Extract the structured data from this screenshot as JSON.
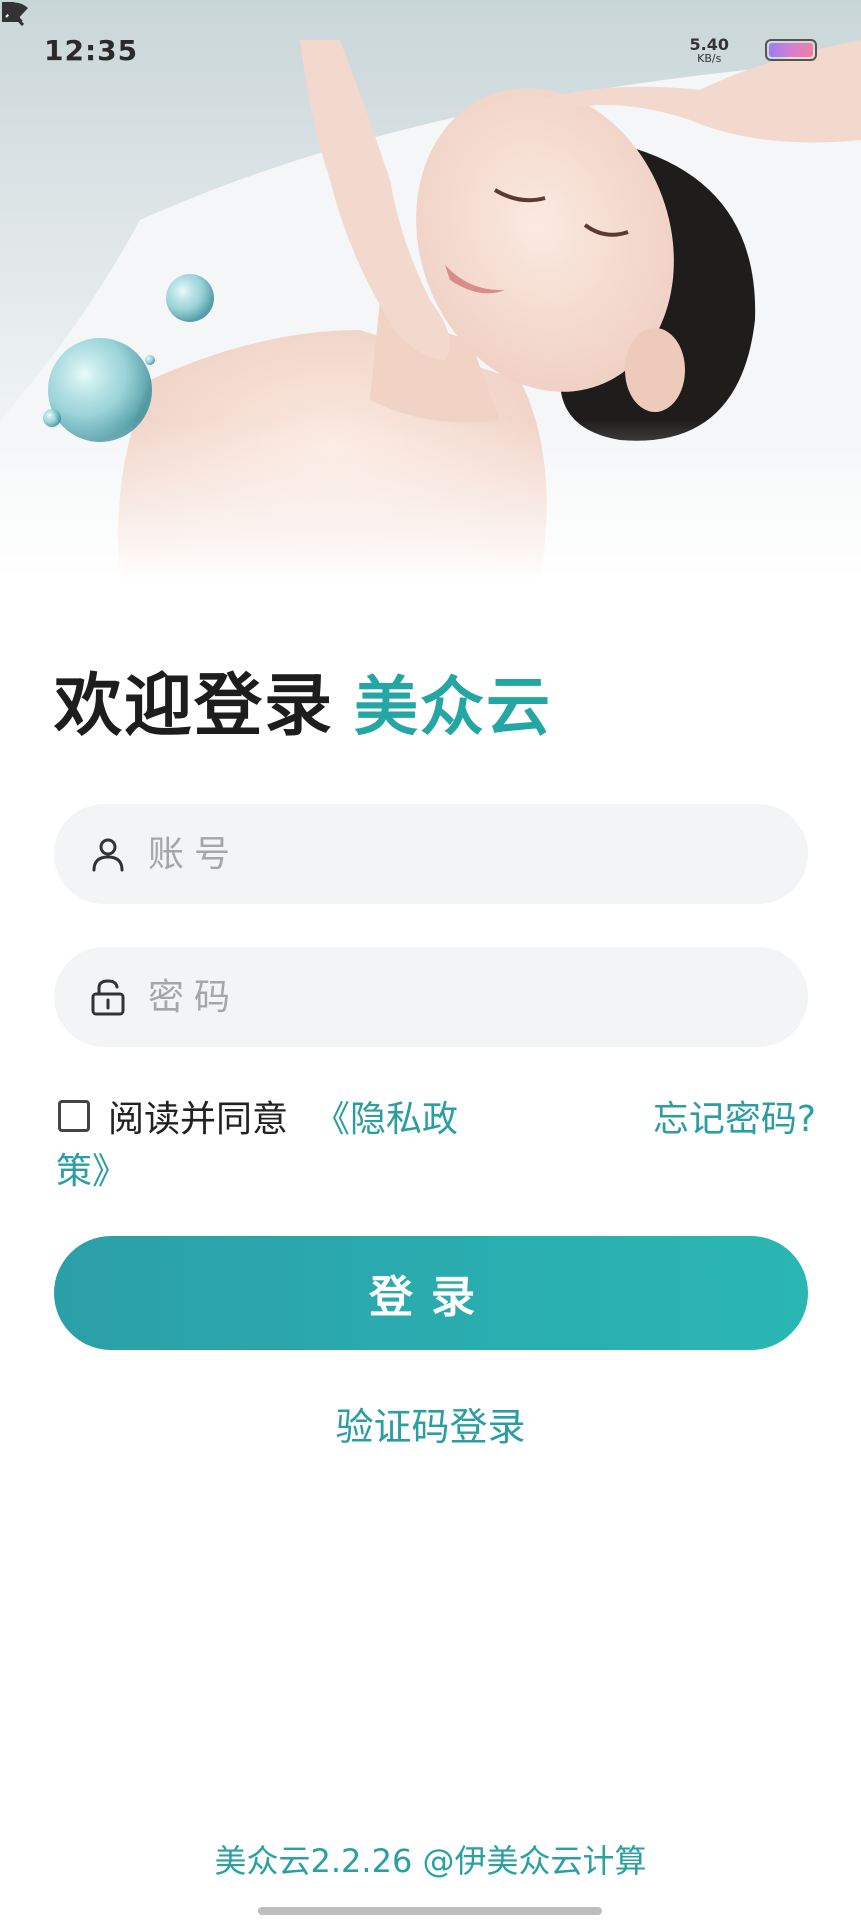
{
  "status_bar": {
    "time": "12:35",
    "net_speed_value": "5.40",
    "net_speed_unit": "KB/s",
    "icons": [
      "mute-bell-icon",
      "sim-off-icon",
      "wifi-icon",
      "battery-icon"
    ]
  },
  "title": {
    "main": "欢迎登录",
    "brand": "美众云"
  },
  "form": {
    "account_placeholder": "账号",
    "password_placeholder": "密码"
  },
  "agreement": {
    "text": "阅读并同意",
    "privacy_line1": "《隐私政",
    "privacy_line2": "策》",
    "forgot_password": "忘记密码?"
  },
  "buttons": {
    "login": "登录",
    "code_login": "验证码登录"
  },
  "footer": {
    "text": "美众云2.2.26 @伊美众云计算"
  },
  "colors": {
    "accent": "#2a9ea3",
    "button_gradient_start": "#2b9fa8",
    "button_gradient_end": "#2ab6b2",
    "input_background": "#f3f4f6"
  }
}
